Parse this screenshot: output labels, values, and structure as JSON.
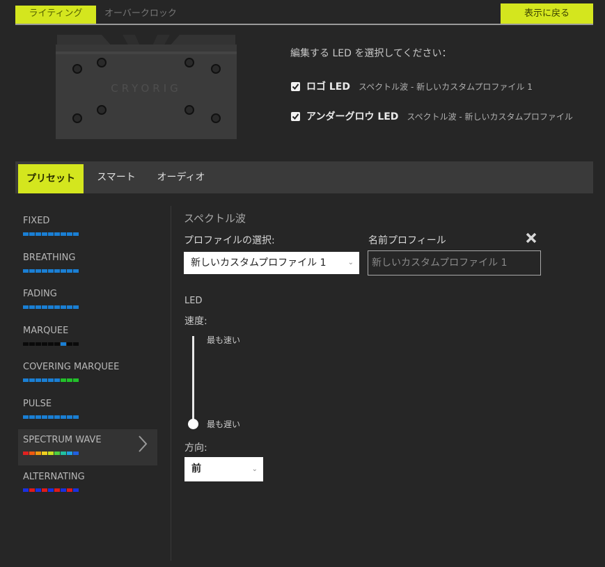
{
  "top_tabs": {
    "lighting": "ライティング",
    "overclock": "オーバークロック"
  },
  "back_button": "表示に戻る",
  "cooler": {
    "brand": "CRYORIG"
  },
  "led_select": {
    "title": "編集する LED を選択してください：",
    "items": [
      {
        "name": "ロゴ LED",
        "description": "スペクトル波 - 新しいカスタムプロファイル 1",
        "checked": true
      },
      {
        "name": "アンダーグロウ LED",
        "description": "スペクトル波 - 新しいカスタムプロファイル",
        "checked": true
      }
    ]
  },
  "mode_tabs": {
    "preset": "プリセット",
    "smart": "スマート",
    "audio": "オーディオ"
  },
  "effects": [
    {
      "label": "FIXED",
      "colors": [
        "#1a7fd4",
        "#1a7fd4",
        "#1a7fd4",
        "#1a7fd4",
        "#1a7fd4",
        "#1a7fd4",
        "#1a7fd4",
        "#1a7fd4",
        "#1a7fd4"
      ]
    },
    {
      "label": "BREATHING",
      "colors": [
        "#1a7fd4",
        "#1a7fd4",
        "#1a7fd4",
        "#1a7fd4",
        "#1a7fd4",
        "#1a7fd4",
        "#1a7fd4",
        "#1a7fd4",
        "#1a7fd4"
      ]
    },
    {
      "label": "FADING",
      "colors": [
        "#1a7fd4",
        "#1a7fd4",
        "#1a7fd4",
        "#1a7fd4",
        "#1a7fd4",
        "#1a7fd4",
        "#1a7fd4",
        "#1a7fd4",
        "#1a7fd4"
      ]
    },
    {
      "label": "MARQUEE",
      "colors": [
        "#0a0a0a",
        "#0a0a0a",
        "#0a0a0a",
        "#0a0a0a",
        "#0a0a0a",
        "#0a0a0a",
        "#1a7fd4",
        "#0a0a0a",
        "#0a0a0a"
      ]
    },
    {
      "label": "COVERING MARQUEE",
      "colors": [
        "#1a7fd4",
        "#1a7fd4",
        "#1a7fd4",
        "#1a7fd4",
        "#1a7fd4",
        "#1a7fd4",
        "#22c02a",
        "#22c02a",
        "#22c02a"
      ]
    },
    {
      "label": "PULSE",
      "colors": [
        "#1a7fd4",
        "#1a7fd4",
        "#1a7fd4",
        "#1a7fd4",
        "#1a7fd4",
        "#1a7fd4",
        "#1a7fd4",
        "#1a7fd4",
        "#1a7fd4"
      ]
    },
    {
      "label": "SPECTRUM WAVE",
      "colors": [
        "#e02020",
        "#f05a10",
        "#f09a10",
        "#f0d020",
        "#c8e020",
        "#50d040",
        "#20c0a0",
        "#20a0e0",
        "#2060e0"
      ],
      "active": true
    },
    {
      "label": "ALTERNATING",
      "colors": [
        "#1a30e0",
        "#e01a1a",
        "#1a30e0",
        "#e01a1a",
        "#1a30e0",
        "#e01a1a",
        "#1a30e0",
        "#e01a1a",
        "#1a30e0"
      ]
    }
  ],
  "panel": {
    "effect_title": "スペクトル波",
    "profile_label": "プロファイルの選択:",
    "profile_value": "新しいカスタムプロファイル 1",
    "name_label": "名前プロフィール",
    "name_value": "新しいカスタムプロファイル 1",
    "led_label": "LED",
    "speed_label": "速度:",
    "speed_max": "最も速い",
    "speed_min": "最も遅い",
    "speed_level": 0,
    "direction_label": "方向:",
    "direction_value": "前"
  },
  "colors": {
    "accent": "#d4e61e",
    "background": "#262626",
    "bar": "#3a3a3a"
  }
}
